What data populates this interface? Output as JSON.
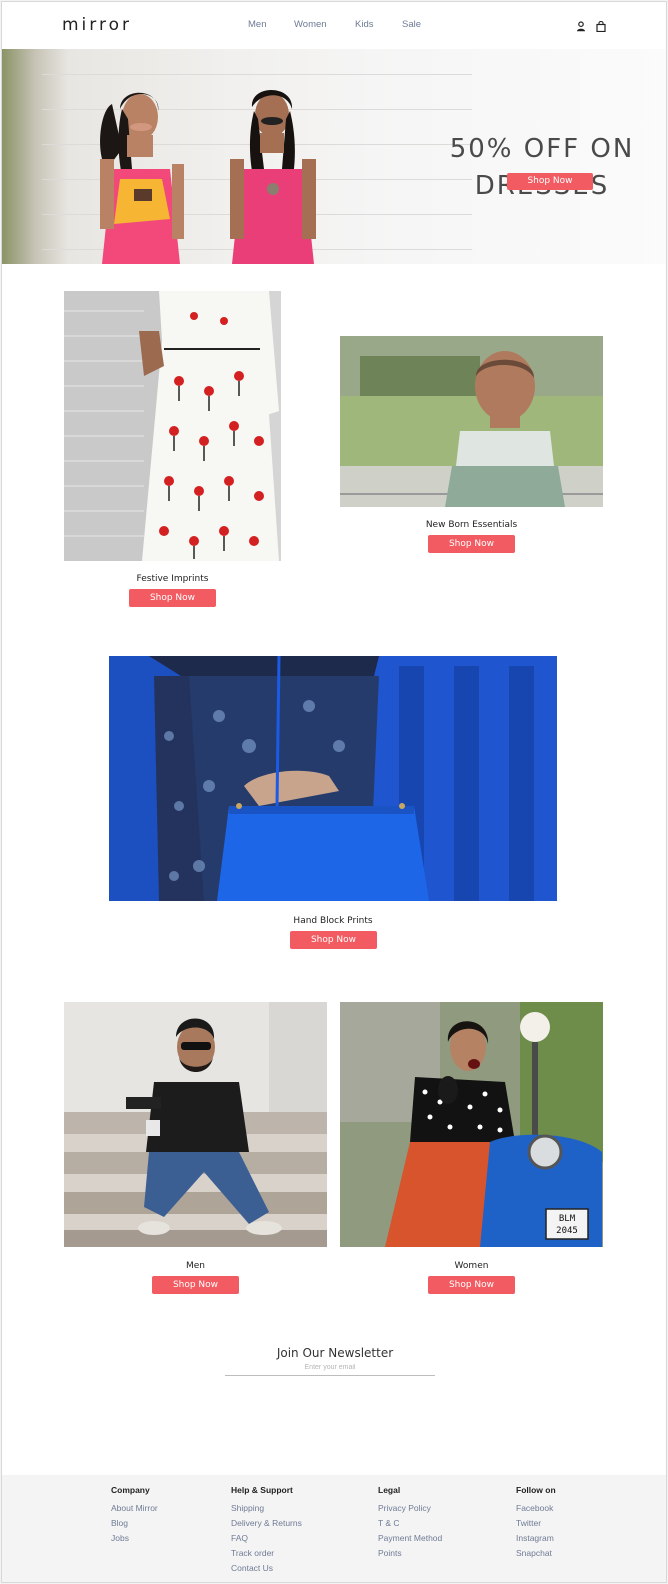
{
  "brand": "mirror",
  "nav": [
    "Men",
    "Women",
    "Kids",
    "Sale"
  ],
  "header_icons": [
    "user-icon",
    "shopping-bag-icon"
  ],
  "hero": {
    "title_line1": "50% OFF ON",
    "title_line2": "DRESSES",
    "cta": "Shop Now"
  },
  "products": [
    {
      "name": "Festive Imprints",
      "cta": "Shop Now"
    },
    {
      "name": "New Born Essentials",
      "cta": "Shop Now"
    },
    {
      "name": "Hand Block Prints",
      "cta": "Shop Now"
    },
    {
      "name": "Men",
      "cta": "Shop Now"
    },
    {
      "name": "Women",
      "cta": "Shop Now"
    }
  ],
  "newsletter": {
    "title": "Join Our Newsletter",
    "placeholder": "Enter your email"
  },
  "footer": {
    "columns": [
      {
        "heading": "Company",
        "links": [
          "About Mirror",
          "Blog",
          "Jobs"
        ]
      },
      {
        "heading": "Help  & Support",
        "links": [
          "Shipping",
          "Delivery &  Returns",
          "FAQ",
          "Track order",
          "Contact Us"
        ]
      },
      {
        "heading": "Legal",
        "links": [
          "Privacy Policy",
          "T & C",
          "Payment Method",
          "Points"
        ]
      },
      {
        "heading": "Follow  on",
        "links": [
          "Facebook",
          "Twitter",
          "Instagram",
          "Snapchat"
        ]
      }
    ]
  },
  "colors": {
    "accent": "#f25b61",
    "nav_text": "#6f7b95",
    "footer_bg": "#f4f4f4"
  }
}
